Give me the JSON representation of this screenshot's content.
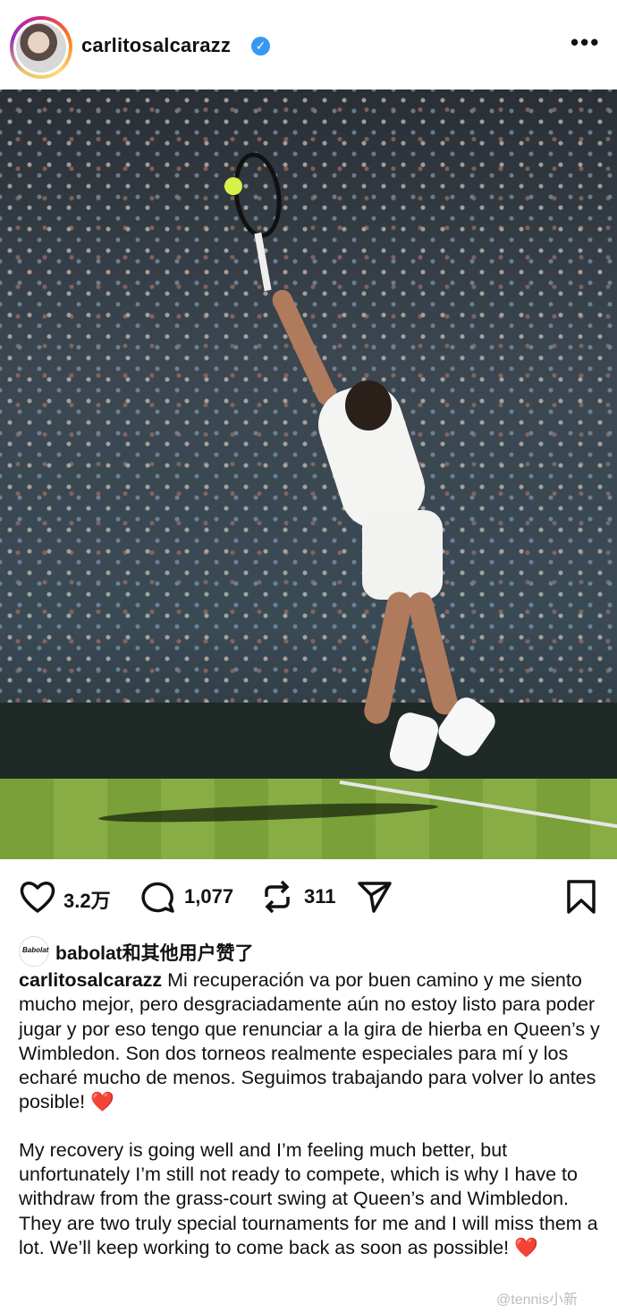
{
  "header": {
    "username": "carlitosalcarazz",
    "verified_icon": "verified-check-icon",
    "more_label": "•••"
  },
  "post_image": {
    "subject": "tennis player serving on grass court"
  },
  "actions": {
    "like_count": "3.2万",
    "comment_count": "1,077",
    "repost_count": "311"
  },
  "likes": {
    "avatar_text": "Babolat",
    "text": "babolat和其他用户赞了"
  },
  "caption": {
    "username": "carlitosalcarazz",
    "spanish": "Mi recuperación va por buen camino y me siento mucho mejor, pero desgraciadamente aún no estoy listo para poder jugar y por eso tengo que renunciar a la gira de hierba en Queen’s y Wimbledon. Son dos torneos realmente especiales para mí y los echaré mucho de menos. Seguimos trabajando para volver lo antes posible!",
    "english": "My recovery is going well and I’m feeling much better, but unfortunately I’m still not ready to compete, which is why I have to withdraw from the grass-court swing at Queen’s and Wimbledon. They are two truly special tournaments for me and I will miss them a lot. We’ll keep working to come back as soon as possible!",
    "heart": "❤️"
  },
  "watermark": "@tennis小新",
  "colors": {
    "verified": "#3897f0",
    "heart": "#e0242f",
    "text": "#111111"
  }
}
